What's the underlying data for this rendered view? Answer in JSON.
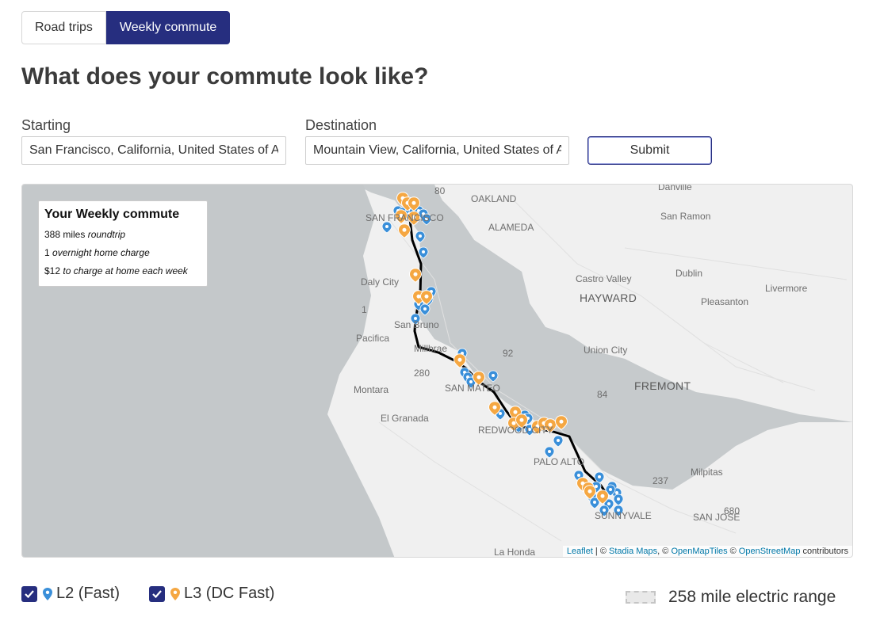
{
  "tabs": [
    {
      "label": "Road trips",
      "active": false
    },
    {
      "label": "Weekly commute",
      "active": true
    }
  ],
  "heading": "What does your commute look like?",
  "form": {
    "starting_label": "Starting",
    "starting_value": "San Francisco, California, United States of America",
    "destination_label": "Destination",
    "destination_value": "Mountain View, California, United States of America",
    "submit_label": "Submit"
  },
  "summary": {
    "title": "Your Weekly commute",
    "miles": "388 miles",
    "miles_suffix": "roundtrip",
    "overnight_count": "1",
    "overnight_text": "overnight home charge",
    "cost": "$12",
    "cost_text": "to charge at home each week"
  },
  "map_labels": {
    "san_francisco": "SAN FRANCISCO",
    "oakland": "OAKLAND",
    "alameda": "ALAMEDA",
    "daly_city": "Daly City",
    "san_bruno": "San Bruno",
    "pacifica": "Pacifica",
    "millbrae": "Millbrae",
    "san_mateo": "SAN MATEO",
    "montara": "Montara",
    "el_granada": "El Granada",
    "redwood_city": "REDWOOD CITY",
    "palo_alto": "PALO ALTO",
    "sunnyvale": "SUNNYVALE",
    "san_jose": "SAN JOSE",
    "milpitas": "Milpitas",
    "fremont": "FREMONT",
    "union_city": "Union City",
    "hayward": "HAYWARD",
    "castro_valley": "Castro Valley",
    "dublin": "Dublin",
    "pleasanton": "Pleasanton",
    "livermore": "Livermore",
    "san_ramon": "San Ramon",
    "danville": "Danville",
    "la_honda": "La Honda",
    "hwy_80": "80",
    "hwy_92": "92",
    "hwy_280": "280",
    "hwy_84": "84",
    "hwy_237": "237",
    "hwy_680": "680",
    "hwy_1": "1"
  },
  "attribution": {
    "leaflet": "Leaflet",
    "stadia": "Stadia Maps",
    "omt": "OpenMapTiles",
    "osm": "OpenStreetMap",
    "suffix": "contributors"
  },
  "legend": {
    "l2_label": "L2 (Fast)",
    "l3_label": "L3 (DC Fast)",
    "range_text": "258 mile electric range"
  },
  "colors": {
    "accent": "#262e7f",
    "l2_marker": "#3a8fd9",
    "l3_marker": "#f5a742",
    "route": "#000000",
    "water": "#c6cacc",
    "land": "#f2f2f2"
  },
  "icons": {
    "l2_marker": "map-pin-icon",
    "l3_marker": "map-pin-icon",
    "checkbox": "check-icon"
  }
}
